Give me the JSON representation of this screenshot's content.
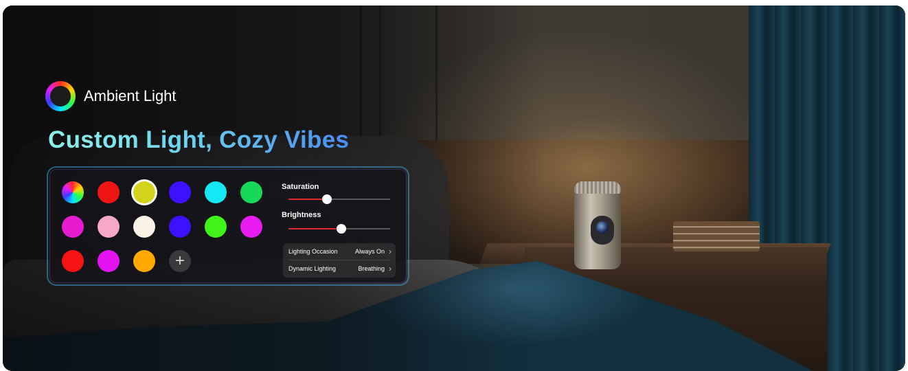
{
  "brand": {
    "label": "Ambient Light"
  },
  "headline": "Custom Light, Cozy Vibes",
  "swatches": [
    {
      "icon": "color-wheel-icon"
    },
    {
      "color": "#f01515"
    },
    {
      "color": "#d4d21a",
      "selected": true
    },
    {
      "color": "#3d10ff"
    },
    {
      "color": "#14e8f2"
    },
    {
      "color": "#18d85a"
    },
    {
      "color": "#e51ccf"
    },
    {
      "color": "#f5a8c8"
    },
    {
      "color": "#fbf4e6"
    },
    {
      "color": "#3d10ff"
    },
    {
      "color": "#3ff416"
    },
    {
      "color": "#e81cf0"
    },
    {
      "color": "#f51313"
    },
    {
      "color": "#e312f0"
    },
    {
      "color": "#ffa800"
    },
    {
      "icon": "plus-icon",
      "add": true,
      "glyph": "+"
    }
  ],
  "saturation": {
    "label": "Saturation",
    "value": 0.38
  },
  "brightness": {
    "label": "Brightness",
    "value": 0.52
  },
  "options": [
    {
      "label": "Lighting Occasion",
      "value": "Always On"
    },
    {
      "label": "Dynamic Lighting",
      "value": "Breathing"
    }
  ],
  "chevron_glyph": "›"
}
